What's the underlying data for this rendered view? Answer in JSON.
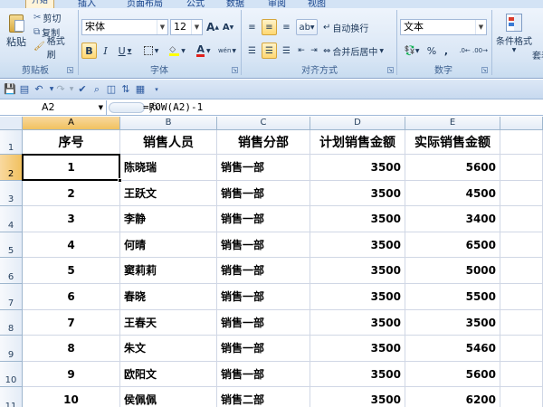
{
  "ribbon": {
    "tabs": [
      "开始",
      "插入",
      "页面布局",
      "公式",
      "数据",
      "审阅",
      "视图"
    ],
    "clipboard": {
      "paste": "粘贴",
      "cut": "剪切",
      "copy": "复制",
      "format_painter": "格式刷",
      "group": "剪贴板"
    },
    "font": {
      "name": "宋体",
      "size": "12",
      "bold": "B",
      "italic": "I",
      "underline": "U",
      "grow": "A",
      "shrink": "A",
      "font_color": "A",
      "phonetic": "wén",
      "group": "字体"
    },
    "alignment": {
      "wrap_text": "自动换行",
      "merge_center": "合并后居中",
      "group": "对齐方式"
    },
    "number": {
      "format": "文本",
      "percent": "%",
      "comma": ",",
      "group": "数字"
    },
    "styles": {
      "conditional_format": "条件格式",
      "table_format": "套表"
    }
  },
  "formula_bar": {
    "name_box": "A2",
    "fx": "fx",
    "formula": "=ROW(A2)-1"
  },
  "sheet": {
    "columns": [
      "A",
      "B",
      "C",
      "D",
      "E"
    ],
    "row_numbers": [
      "1",
      "2",
      "3",
      "4",
      "5",
      "6",
      "7",
      "8",
      "9",
      "10",
      "11"
    ],
    "header": [
      "序号",
      "销售人员",
      "销售分部",
      "计划销售金额",
      "实际销售金额"
    ],
    "rows": [
      [
        "1",
        "陈晓瑞",
        "销售一部",
        "3500",
        "5600"
      ],
      [
        "2",
        "王跃文",
        "销售一部",
        "3500",
        "4500"
      ],
      [
        "3",
        "李静",
        "销售一部",
        "3500",
        "3400"
      ],
      [
        "4",
        "何晴",
        "销售一部",
        "3500",
        "6500"
      ],
      [
        "5",
        "窦莉莉",
        "销售一部",
        "3500",
        "5000"
      ],
      [
        "6",
        "春晓",
        "销售一部",
        "3500",
        "5500"
      ],
      [
        "7",
        "王春天",
        "销售一部",
        "3500",
        "3500"
      ],
      [
        "8",
        "朱文",
        "销售一部",
        "3500",
        "5460"
      ],
      [
        "9",
        "欧阳文",
        "销售一部",
        "3500",
        "5600"
      ],
      [
        "10",
        "侯佩佩",
        "销售二部",
        "3500",
        "6200"
      ]
    ]
  },
  "active_cell": "A2",
  "colors": {
    "accent": "#f1c15f",
    "ribbon": "#d9e6f5",
    "grid": "#d0d7e5"
  }
}
